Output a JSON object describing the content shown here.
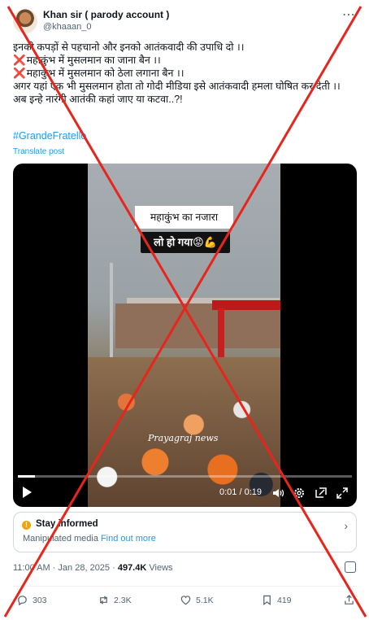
{
  "author": {
    "name": "Khan sir ( parody account )",
    "handle": "@khaaan_0"
  },
  "post": {
    "lines": [
      "इनको कपड़ों से पहचानो और इनको आतंकवादी की उपाधि दो ।।",
      "महाकुंभ में मुसलमान का जाना बैन ।।",
      "महाकुंभ में मुसलमान को ठेला लगाना बैन ।।",
      "अगर यहां एक भी मुसलमान होता तो गोदी मीडिया  इसे आतंकवादी हमला घोषित कर देती ।।",
      "अब इन्हे नारंगी आतंकी कहां जाए या कटवा..?!"
    ],
    "x_mark": "❌",
    "hashtag": "#GrandeFratello",
    "translate": "Translate post"
  },
  "video": {
    "caption_top": "महाकुंभ का नजारा",
    "caption_bottom": "लो हो गया😡💪",
    "watermark": "Prayagraj news",
    "time": "0:01 / 0:19",
    "progress": 0.05
  },
  "notice": {
    "icon": "!",
    "title": "Stay informed",
    "body": "Manipulated media",
    "link": "Find out more",
    "chevron": "›"
  },
  "meta": {
    "timestamp": "11:00 AM · Jan 28, 2025",
    "separator": " · ",
    "views_count": "497.4K",
    "views_label": " Views"
  },
  "actions": {
    "replies": "303",
    "reposts": "2.3K",
    "likes": "5.1K",
    "bookmarks": "419"
  },
  "overlay_color": "#e8251c"
}
